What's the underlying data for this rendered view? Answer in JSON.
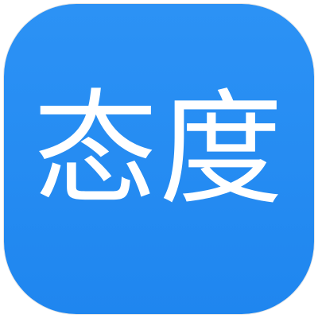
{
  "app_icon": {
    "label": "态度",
    "background_color": "#1f86ef",
    "text_color": "#ffffff"
  }
}
